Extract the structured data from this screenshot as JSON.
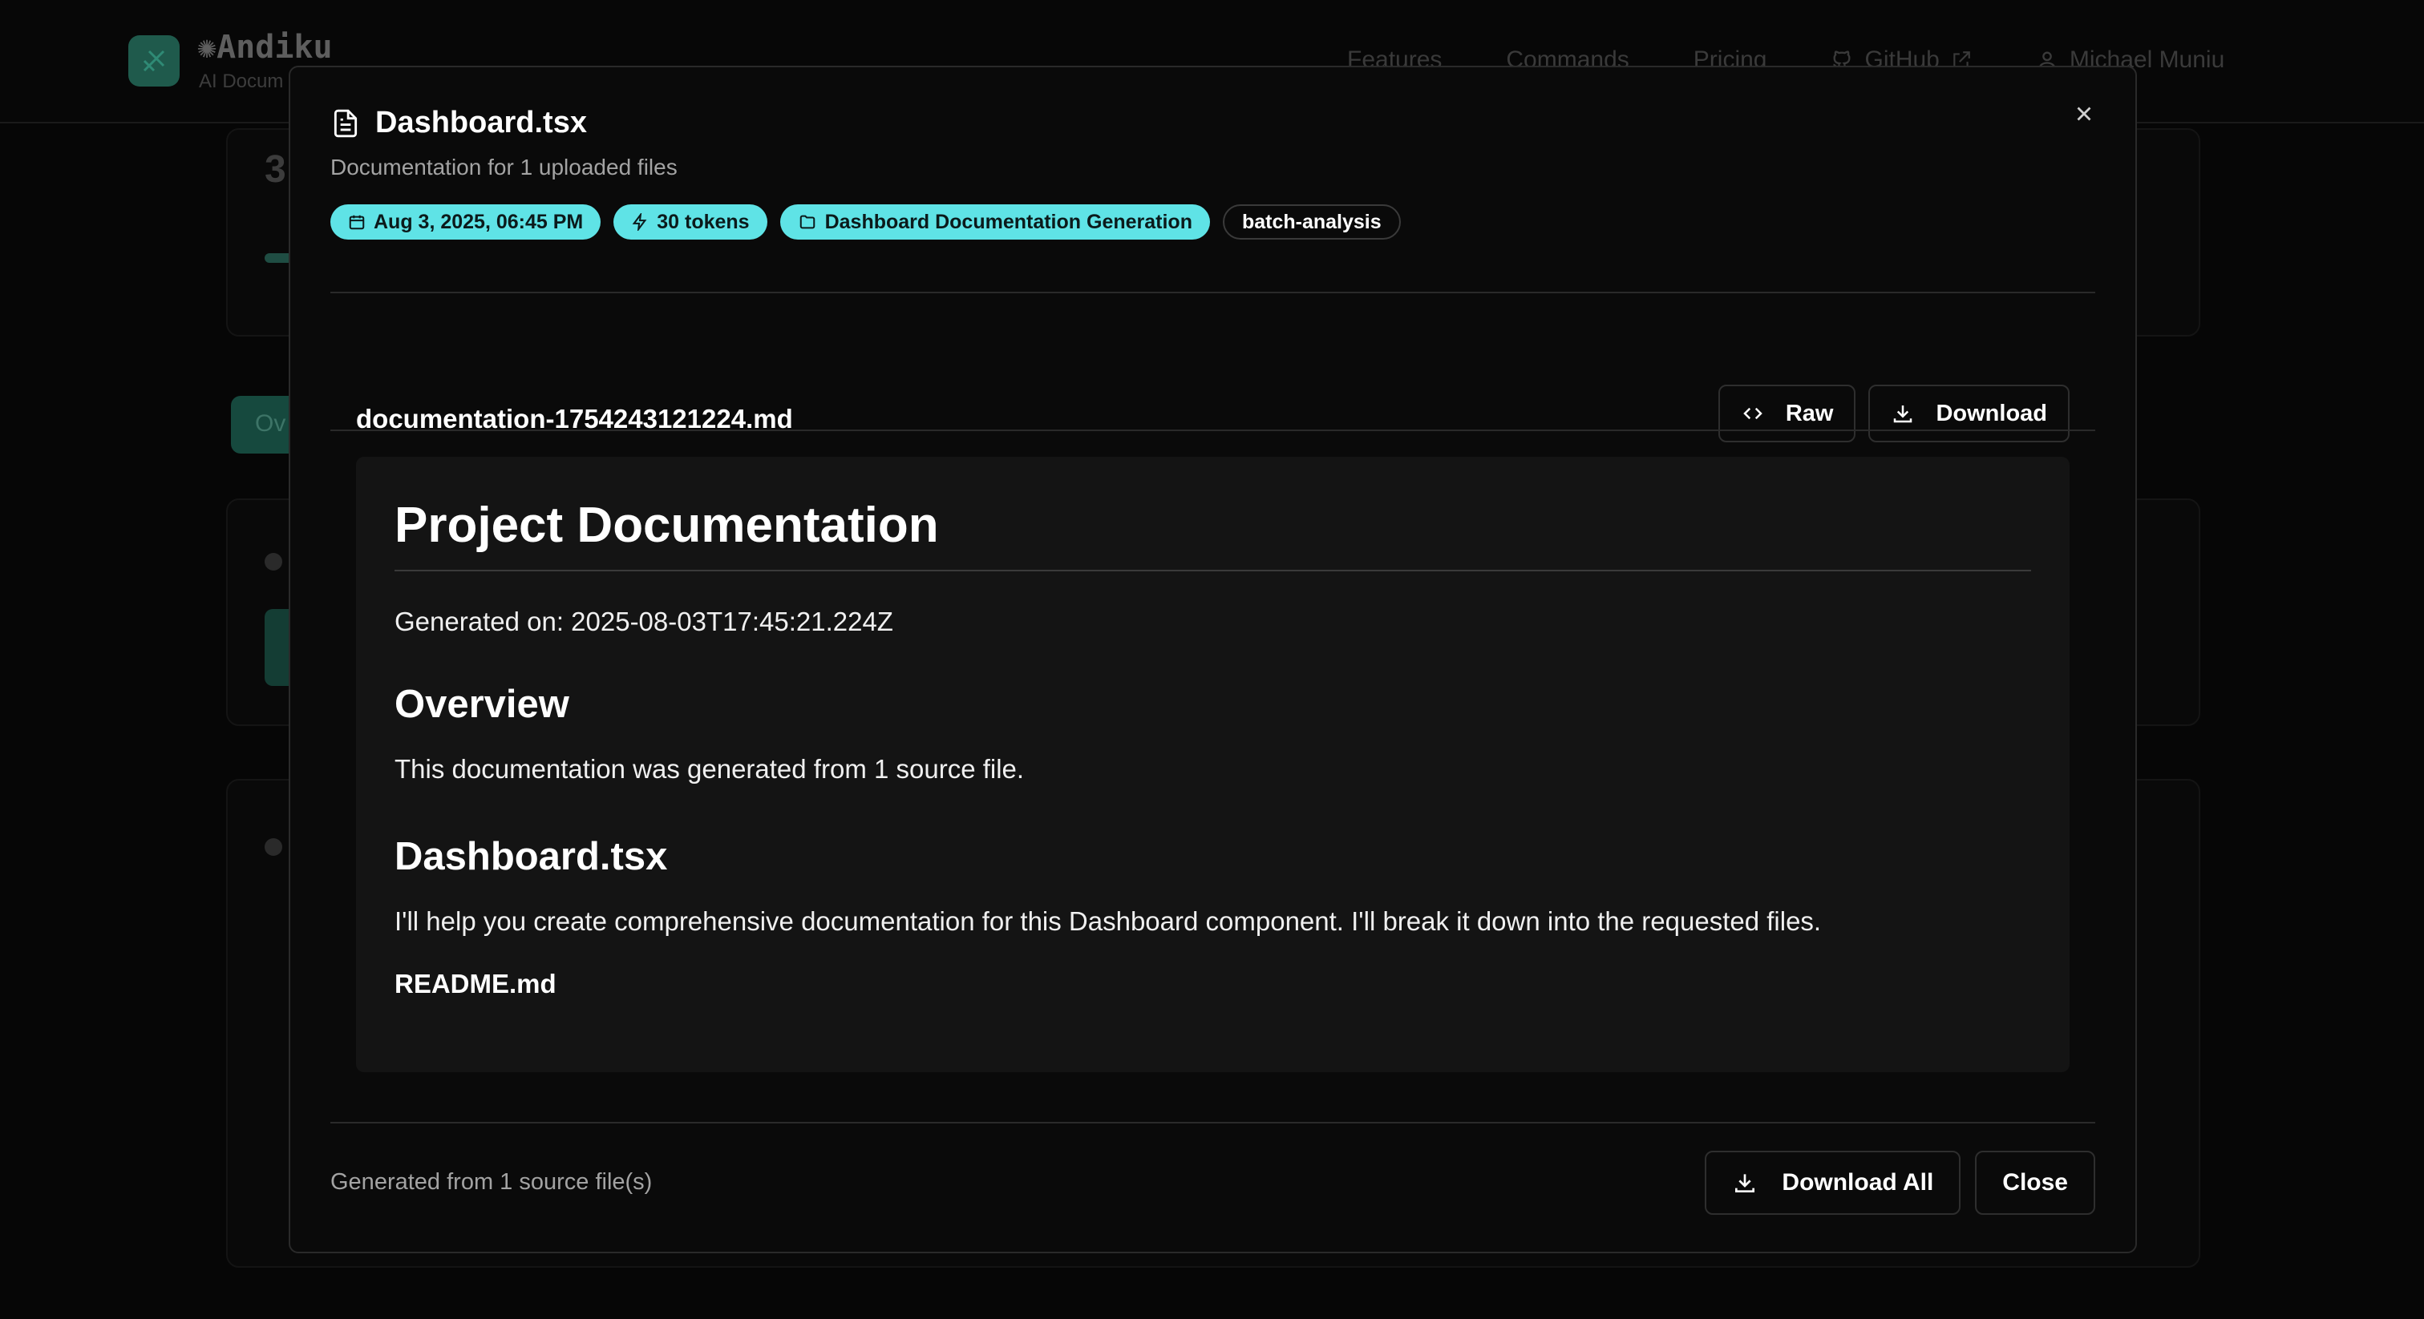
{
  "app": {
    "brand": "Andiku",
    "brand_sub": "AI Docum",
    "nav": [
      "Features",
      "Commands",
      "Pricing",
      "GitHub"
    ],
    "user": "Michael Muniu",
    "bg_number": "3",
    "bg_tab_label": "Ov"
  },
  "modal": {
    "title": "Dashboard.tsx",
    "subtitle": "Documentation for 1 uploaded files",
    "badges": {
      "date": "Aug 3, 2025, 06:45 PM",
      "tokens": "30 tokens",
      "project": "Dashboard Documentation Generation",
      "tag": "batch-analysis"
    },
    "file_name": "documentation-1754243121224.md",
    "raw_label": "Raw",
    "download_label": "Download",
    "doc": {
      "h1": "Project Documentation",
      "generated": "Generated on: 2025-08-03T17:45:21.224Z",
      "overview_heading": "Overview",
      "overview_text": "This documentation was generated from 1 source file.",
      "file_heading": "Dashboard.tsx",
      "file_text": "I'll help you create comprehensive documentation for this Dashboard component. I'll break it down into the requested files.",
      "readme": "README.md"
    },
    "footer_text": "Generated from 1 source file(s)",
    "download_all_label": "Download All",
    "close_label": "Close"
  },
  "colors": {
    "accent_badge": "#5fe3e6",
    "brand_green": "#1f5a4c"
  },
  "icons": {
    "title": "file-text-icon",
    "date": "calendar-icon",
    "tokens": "zap-icon",
    "project": "folder-icon",
    "raw": "code-icon",
    "download": "download-icon",
    "close": "x-icon"
  }
}
